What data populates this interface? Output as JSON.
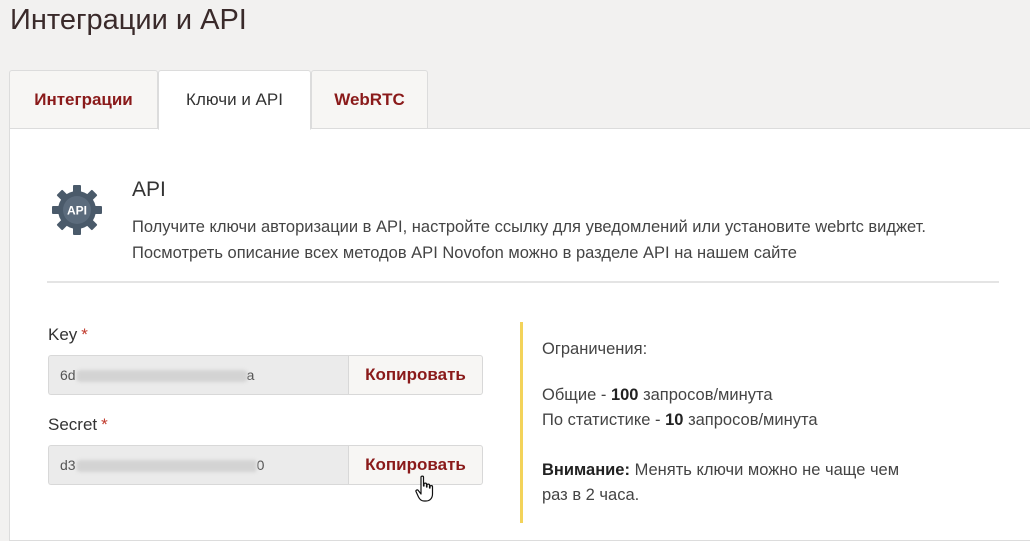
{
  "page": {
    "title": "Интеграции и API"
  },
  "tabs": [
    {
      "label": "Интеграции",
      "active": false
    },
    {
      "label": "Ключи и API",
      "active": true
    },
    {
      "label": "WebRTC",
      "active": false
    }
  ],
  "api": {
    "icon": "api-gear-icon",
    "icon_text": "API",
    "title": "API",
    "desc_line1": "Получите ключи авторизации в API, настройте ссылку для уведомлений или установите webrtc виджет.",
    "desc_line2": "Посмотреть описание всех методов API Novofon можно в разделе API на нашем сайте"
  },
  "key": {
    "label": "Key",
    "required_mark": "*",
    "value_prefix": "6d",
    "value_suffix": "a",
    "copy_label": "Копировать"
  },
  "secret": {
    "label": "Secret",
    "required_mark": "*",
    "value_prefix": "d3",
    "value_suffix": "0",
    "copy_label": "Копировать"
  },
  "limits": {
    "heading": "Ограничения:",
    "general_prefix": "Общие -",
    "general_value": "100",
    "general_suffix": "запросов/минута",
    "stats_prefix": "По статистике -",
    "stats_value": "10",
    "stats_suffix": "запросов/минута",
    "warning_label": "Внимание:",
    "warning_line1": "Менять ключи можно не чаще чем",
    "warning_line2": "раз в 2 часа."
  },
  "colors": {
    "accent": "#8a1a1a",
    "limits_bar": "#f3d35a",
    "required": "#c0392b",
    "icon": "#4a5a6a"
  }
}
